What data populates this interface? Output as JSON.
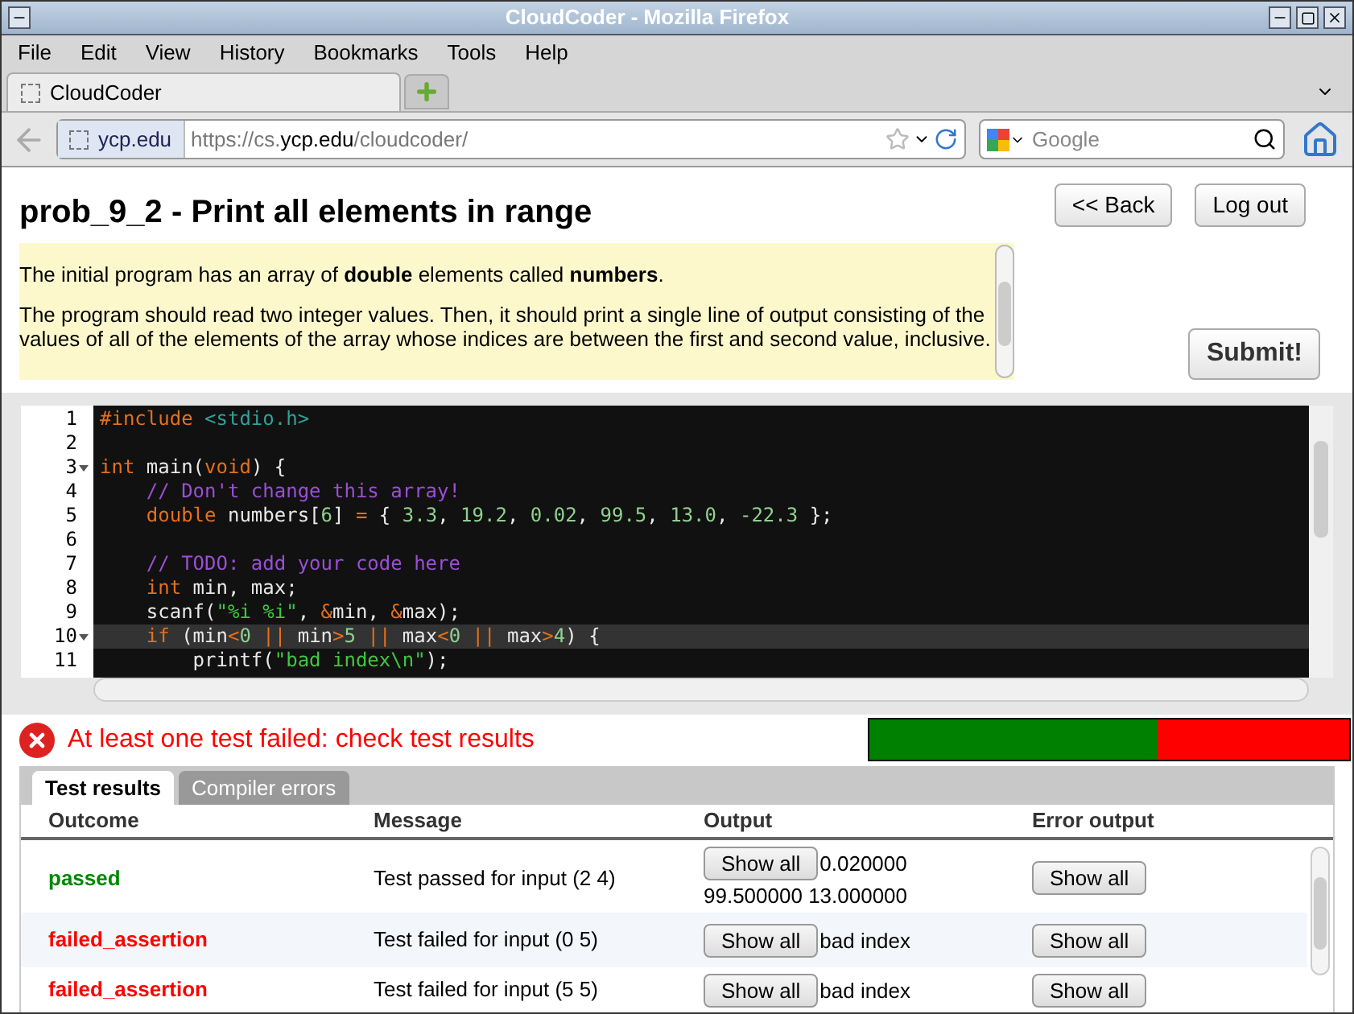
{
  "window": {
    "title": "CloudCoder - Mozilla Firefox"
  },
  "menu": [
    "File",
    "Edit",
    "View",
    "History",
    "Bookmarks",
    "Tools",
    "Help"
  ],
  "tabs": [
    {
      "label": "CloudCoder",
      "selected": true
    }
  ],
  "address_bar": {
    "site": "ycp.edu",
    "url_prefix": "https://cs.",
    "url_domain": "ycp.edu",
    "url_path": "/cloudcoder/"
  },
  "search": {
    "placeholder": "Google"
  },
  "problem": {
    "title": "prob_9_2 - Print all elements in range",
    "back": "<< Back",
    "logout": "Log out",
    "submit": "Submit!",
    "description": [
      "The initial program has an array of **double** elements called **numbers**.",
      "The program should read two integer values. Then, it should print a single line of output consisting of the values of all of the elements of the array whose indices are between the first and second value, inclusive."
    ]
  },
  "editor": {
    "lines": [
      {
        "number": "1",
        "fold": false,
        "current": false,
        "tokens": [
          {
            "t": "#include ",
            "color": "#e6701a"
          },
          {
            "t": "<stdio.h>",
            "color": "#2fa39a"
          }
        ]
      },
      {
        "number": "2",
        "fold": false,
        "current": false
      },
      {
        "number": "3",
        "fold": true,
        "current": false,
        "tokens": [
          {
            "t": "int",
            "color": "#e6701a"
          },
          {
            "t": " main(",
            "color": "#e8e8e8"
          },
          {
            "t": "void",
            "color": "#e6701a"
          },
          {
            "t": ") {",
            "color": "#e8e8e8"
          }
        ]
      },
      {
        "number": "4",
        "fold": false,
        "current": false,
        "tokens": [
          {
            "t": "    // Don't change this array!",
            "color": "#9b4fd6"
          }
        ]
      },
      {
        "number": "5",
        "fold": false,
        "current": false,
        "tokens": [
          {
            "t": "    double",
            "color": "#e6701a"
          },
          {
            "t": " numbers[",
            "color": "#e8e8e8"
          },
          {
            "t": "6",
            "color": "#8fd18f"
          },
          {
            "t": "] ",
            "color": "#e8e8e8"
          },
          {
            "t": "=",
            "color": "#e6701a"
          },
          {
            "t": " { ",
            "color": "#e8e8e8"
          },
          {
            "t": "3.3",
            "color": "#8fd18f"
          },
          {
            "t": ", ",
            "color": "#e8e8e8"
          },
          {
            "t": "19.2",
            "color": "#8fd18f"
          },
          {
            "t": ", ",
            "color": "#e8e8e8"
          },
          {
            "t": "0.02",
            "color": "#8fd18f"
          },
          {
            "t": ", ",
            "color": "#e8e8e8"
          },
          {
            "t": "99.5",
            "color": "#8fd18f"
          },
          {
            "t": ", ",
            "color": "#e8e8e8"
          },
          {
            "t": "13.0",
            "color": "#8fd18f"
          },
          {
            "t": ", ",
            "color": "#e8e8e8"
          },
          {
            "t": "-22.3",
            "color": "#8fd18f"
          },
          {
            "t": " };",
            "color": "#e8e8e8"
          }
        ]
      },
      {
        "number": "6",
        "fold": false,
        "current": false
      },
      {
        "number": "7",
        "fold": false,
        "current": false,
        "tokens": [
          {
            "t": "    // TODO: add your code here",
            "color": "#9b4fd6"
          }
        ]
      },
      {
        "number": "8",
        "fold": false,
        "current": false,
        "tokens": [
          {
            "t": "    int",
            "color": "#e6701a"
          },
          {
            "t": " min, max;",
            "color": "#e8e8e8"
          }
        ]
      },
      {
        "number": "9",
        "fold": false,
        "current": false,
        "tokens": [
          {
            "t": "    scanf(",
            "color": "#e8e8e8"
          },
          {
            "t": "\"%i %i\"",
            "color": "#3fc83f"
          },
          {
            "t": ", ",
            "color": "#e8e8e8"
          },
          {
            "t": "&",
            "color": "#e6701a"
          },
          {
            "t": "min, ",
            "color": "#e8e8e8"
          },
          {
            "t": "&",
            "color": "#e6701a"
          },
          {
            "t": "max);",
            "color": "#e8e8e8"
          }
        ]
      },
      {
        "number": "10",
        "fold": true,
        "current": true,
        "tokens": [
          {
            "t": "    if",
            "color": "#e6701a"
          },
          {
            "t": " (min",
            "color": "#e8e8e8"
          },
          {
            "t": "<",
            "color": "#e6701a"
          },
          {
            "t": "0",
            "color": "#8fd18f"
          },
          {
            "t": " || ",
            "color": "#e6701a"
          },
          {
            "t": "min",
            "color": "#e8e8e8"
          },
          {
            "t": ">",
            "color": "#e6701a"
          },
          {
            "t": "5",
            "color": "#8fd18f"
          },
          {
            "t": " || ",
            "color": "#e6701a"
          },
          {
            "t": "max",
            "color": "#e8e8e8"
          },
          {
            "t": "<",
            "color": "#e6701a"
          },
          {
            "t": "0",
            "color": "#8fd18f"
          },
          {
            "t": " || ",
            "color": "#e6701a"
          },
          {
            "t": "max",
            "color": "#e8e8e8"
          },
          {
            "t": ">",
            "color": "#e6701a"
          },
          {
            "t": "4",
            "color": "#8fd18f"
          },
          {
            "t": ") {",
            "color": "#e8e8e8"
          }
        ]
      },
      {
        "number": "11",
        "fold": false,
        "current": false,
        "tokens": [
          {
            "t": "        printf(",
            "color": "#e8e8e8"
          },
          {
            "t": "\"bad index\\n\"",
            "color": "#3fc83f"
          },
          {
            "t": ");",
            "color": "#e8e8e8"
          }
        ]
      }
    ]
  },
  "status": {
    "message": "At least one test failed: check test results",
    "level": 0.6
  },
  "result_tabs": [
    {
      "label": "Test results",
      "selected": true
    },
    {
      "label": "Compiler errors",
      "selected": false
    }
  ],
  "table": {
    "columns": [
      "Outcome",
      "Message",
      "Output",
      "Error output"
    ],
    "rows": [
      {
        "outcome": "passed",
        "kind": "passed",
        "message": "Test passed for input (2 4)",
        "output_button": "Show all",
        "output_lines": [
          "0.020000",
          "99.500000 13.000000"
        ],
        "error_button": "Show all"
      },
      {
        "outcome": "failed_assertion",
        "kind": "failed",
        "message": "Test failed for input (0 5)",
        "output_button": "Show all",
        "output_lines": [
          "bad index"
        ],
        "error_button": "Show all"
      },
      {
        "outcome": "failed_assertion",
        "kind": "failed",
        "message": "Test failed for input (5 5)",
        "output_button": "Show all",
        "output_lines": [
          "bad index"
        ],
        "error_button": "Show all"
      }
    ]
  }
}
